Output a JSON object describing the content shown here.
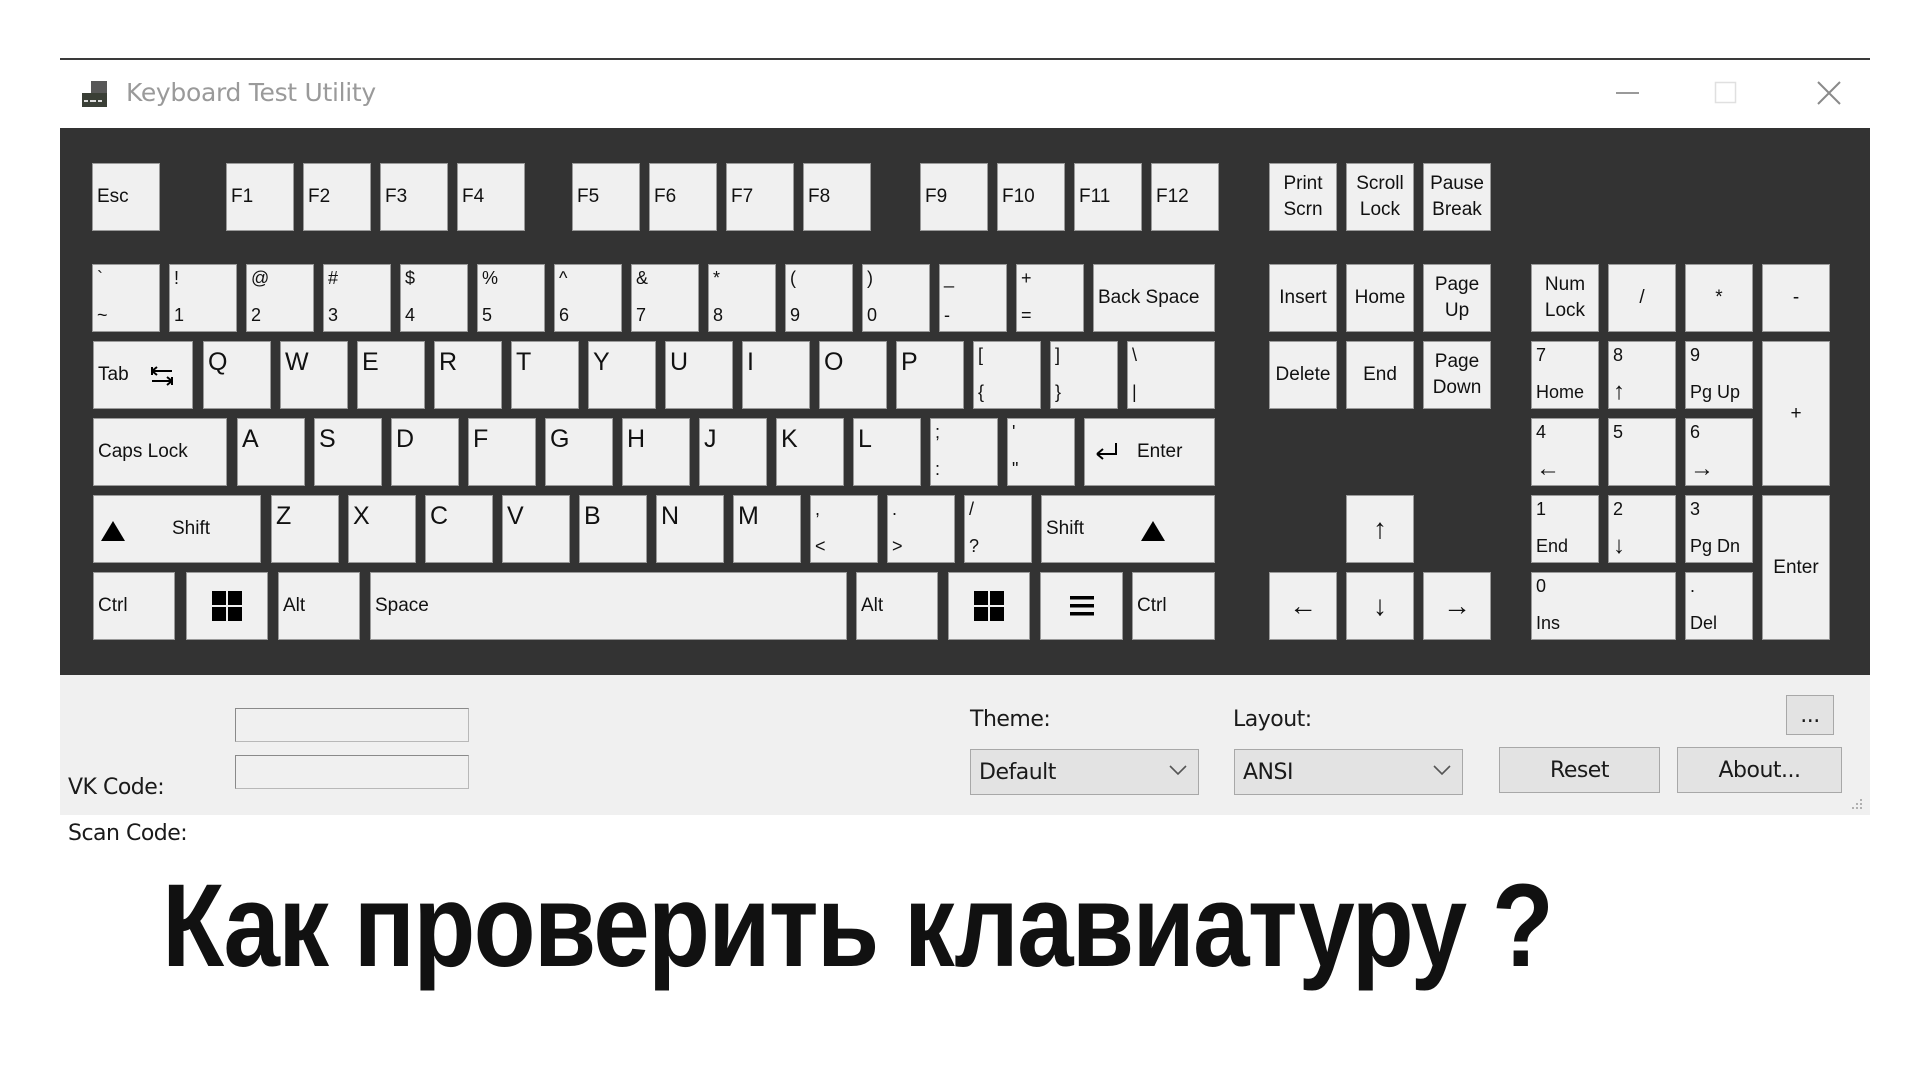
{
  "window": {
    "title": "Keyboard Test Utility",
    "controls": {
      "minimize": "minimize-icon",
      "maximize": "maximize-icon",
      "close": "close-icon"
    }
  },
  "keyboard": {
    "function_row": [
      {
        "id": "esc",
        "label": "Esc"
      },
      {
        "id": "f1",
        "label": "F1"
      },
      {
        "id": "f2",
        "label": "F2"
      },
      {
        "id": "f3",
        "label": "F3"
      },
      {
        "id": "f4",
        "label": "F4"
      },
      {
        "id": "f5",
        "label": "F5"
      },
      {
        "id": "f6",
        "label": "F6"
      },
      {
        "id": "f7",
        "label": "F7"
      },
      {
        "id": "f8",
        "label": "F8"
      },
      {
        "id": "f9",
        "label": "F9"
      },
      {
        "id": "f10",
        "label": "F10"
      },
      {
        "id": "f11",
        "label": "F11"
      },
      {
        "id": "f12",
        "label": "F12"
      }
    ],
    "system_keys": [
      {
        "id": "print-scrn",
        "label": "Print\nScrn"
      },
      {
        "id": "scroll-lock",
        "label": "Scroll\nLock"
      },
      {
        "id": "pause-break",
        "label": "Pause\nBreak"
      }
    ],
    "number_row": [
      {
        "id": "backtick",
        "top": "`",
        "bottom": "~"
      },
      {
        "id": "1",
        "top": "!",
        "bottom": "1"
      },
      {
        "id": "2",
        "top": "@",
        "bottom": "2"
      },
      {
        "id": "3",
        "top": "#",
        "bottom": "3"
      },
      {
        "id": "4",
        "top": "$",
        "bottom": "4"
      },
      {
        "id": "5",
        "top": "%",
        "bottom": "5"
      },
      {
        "id": "6",
        "top": "^",
        "bottom": "6"
      },
      {
        "id": "7",
        "top": "&",
        "bottom": "7"
      },
      {
        "id": "8",
        "top": "*",
        "bottom": "8"
      },
      {
        "id": "9",
        "top": "(",
        "bottom": "9"
      },
      {
        "id": "0",
        "top": ")",
        "bottom": "0"
      },
      {
        "id": "minus",
        "top": "_",
        "bottom": "-"
      },
      {
        "id": "equals",
        "top": "+",
        "bottom": "="
      }
    ],
    "backspace": "Back Space",
    "tab": "Tab",
    "qwerty_row": [
      "Q",
      "W",
      "E",
      "R",
      "T",
      "Y",
      "U",
      "I",
      "O",
      "P"
    ],
    "bracket_keys": [
      {
        "id": "lbracket",
        "top": "[",
        "bottom": "{"
      },
      {
        "id": "rbracket",
        "top": "]",
        "bottom": "}"
      },
      {
        "id": "backslash",
        "top": "\\",
        "bottom": "|"
      }
    ],
    "caps_lock": "Caps Lock",
    "home_row": [
      "A",
      "S",
      "D",
      "F",
      "G",
      "H",
      "J",
      "K",
      "L"
    ],
    "home_row_punct": [
      {
        "id": "semicolon",
        "top": ";",
        "bottom": ":"
      },
      {
        "id": "quote",
        "top": "'",
        "bottom": "\""
      }
    ],
    "enter": "Enter",
    "shift": "Shift",
    "bottom_letter_row": [
      "Z",
      "X",
      "C",
      "V",
      "B",
      "N",
      "M"
    ],
    "bottom_letter_punct": [
      {
        "id": "comma",
        "top": ",",
        "bottom": "<"
      },
      {
        "id": "period",
        "top": ".",
        "bottom": ">"
      },
      {
        "id": "slash",
        "top": "/",
        "bottom": "?"
      }
    ],
    "ctrl": "Ctrl",
    "alt": "Alt",
    "space": "Space",
    "nav_keys": [
      {
        "id": "insert",
        "label": "Insert"
      },
      {
        "id": "home",
        "label": "Home"
      },
      {
        "id": "page-up",
        "label": "Page\nUp"
      },
      {
        "id": "delete",
        "label": "Delete"
      },
      {
        "id": "end",
        "label": "End"
      },
      {
        "id": "page-down",
        "label": "Page\nDown"
      }
    ],
    "arrows": {
      "up": "↑",
      "left": "←",
      "down": "↓",
      "right": "→"
    },
    "numpad": {
      "num_lock": "Num\nLock",
      "divide": "/",
      "multiply": "*",
      "subtract": "-",
      "add": "+",
      "enter": "Enter",
      "keys": [
        {
          "id": "np7",
          "top": "7",
          "bottom": "Home"
        },
        {
          "id": "np8",
          "top": "8",
          "bottom": "↑"
        },
        {
          "id": "np9",
          "top": "9",
          "bottom": "Pg Up"
        },
        {
          "id": "np4",
          "top": "4",
          "bottom": "←"
        },
        {
          "id": "np5",
          "top": "5",
          "bottom": ""
        },
        {
          "id": "np6",
          "top": "6",
          "bottom": "→"
        },
        {
          "id": "np1",
          "top": "1",
          "bottom": "End"
        },
        {
          "id": "np2",
          "top": "2",
          "bottom": "↓"
        },
        {
          "id": "np3",
          "top": "3",
          "bottom": "Pg Dn"
        },
        {
          "id": "np0",
          "top": "0",
          "bottom": "Ins"
        },
        {
          "id": "npdot",
          "top": ".",
          "bottom": "Del"
        }
      ]
    }
  },
  "panel": {
    "vk_code_label": "VK Code:",
    "vk_code_value": "",
    "scan_code_label": "Scan Code:",
    "scan_code_value": "",
    "theme_label": "Theme:",
    "theme_selected": "Default",
    "layout_label": "Layout:",
    "layout_selected": "ANSI",
    "more_button": "...",
    "reset_button": "Reset",
    "about_button": "About..."
  },
  "headline": "Как проверить клавиатуру ?"
}
